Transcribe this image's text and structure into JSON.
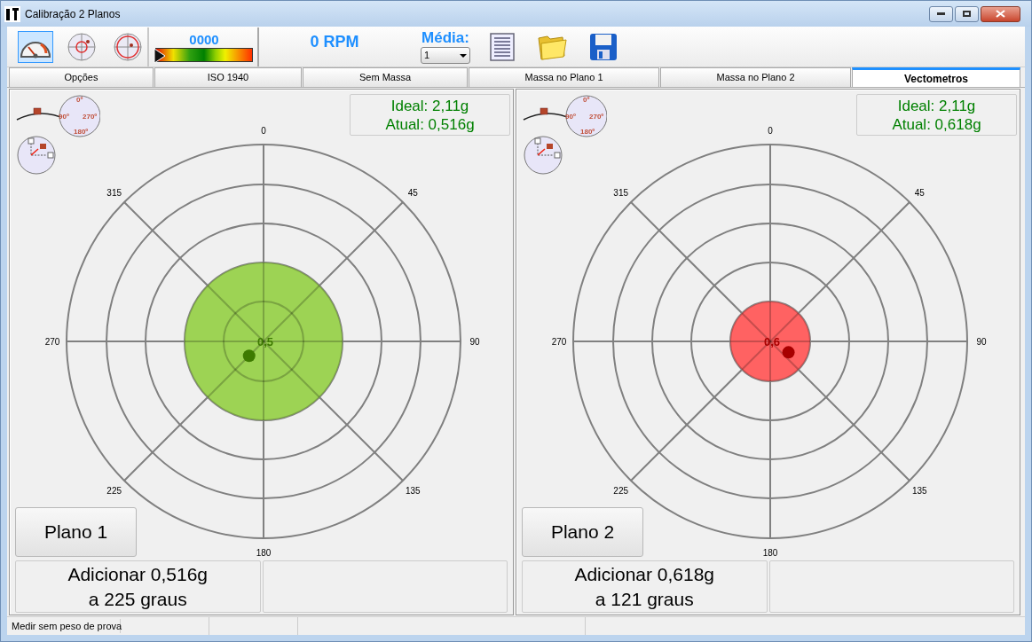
{
  "window": {
    "title": "Calibração 2 Planos"
  },
  "toolbar": {
    "mode_buttons": [
      {
        "kind": "gauge",
        "selected": true
      },
      {
        "kind": "target-center",
        "selected": false
      },
      {
        "kind": "target",
        "selected": false
      }
    ],
    "counter": "0000",
    "meter": {
      "level": 0
    },
    "rpm": "0 RPM",
    "media": {
      "label": "Média:",
      "value": "1"
    },
    "actions": [
      {
        "kind": "report"
      },
      {
        "kind": "open"
      },
      {
        "kind": "save"
      }
    ]
  },
  "tabs": [
    {
      "label": "Opções",
      "selected": false
    },
    {
      "label": "ISO 1940",
      "selected": false
    },
    {
      "label": "Sem Massa",
      "selected": false
    },
    {
      "label": "Massa no Plano 1",
      "selected": false
    },
    {
      "label": "Massa no Plano 2",
      "selected": false
    },
    {
      "label": "Vectometros",
      "selected": true
    }
  ],
  "panels": [
    {
      "dial_labels": [
        "0º",
        "90º",
        "270º",
        "180º"
      ],
      "ideal": "Ideal: 2,11g",
      "atual": "Atual: 0,516g",
      "axis_labels": [
        "0",
        "45",
        "90",
        "135",
        "180",
        "225",
        "270",
        "315"
      ],
      "zone": {
        "color": "#9dd354"
      },
      "center_label": "0,5",
      "vector": {
        "color": "#3d7a00"
      },
      "plane_button": "Plano 1",
      "result": [
        "Adicionar 0,516g",
        "a 225 graus"
      ]
    },
    {
      "dial_labels": [
        "0º",
        "90º",
        "270º",
        "180º"
      ],
      "ideal": "Ideal: 2,11g",
      "atual": "Atual: 0,618g",
      "axis_labels": [
        "0",
        "45",
        "90",
        "135",
        "180",
        "225",
        "270",
        "315"
      ],
      "zone": {
        "color": "#ff6262"
      },
      "center_label": "0,6",
      "vector": {
        "color": "#a80000"
      },
      "plane_button": "Plano 2",
      "result": [
        "Adicionar 0,618g",
        "a 121 graus"
      ]
    }
  ],
  "status_bar": {
    "message": "Medir sem peso de prova"
  }
}
